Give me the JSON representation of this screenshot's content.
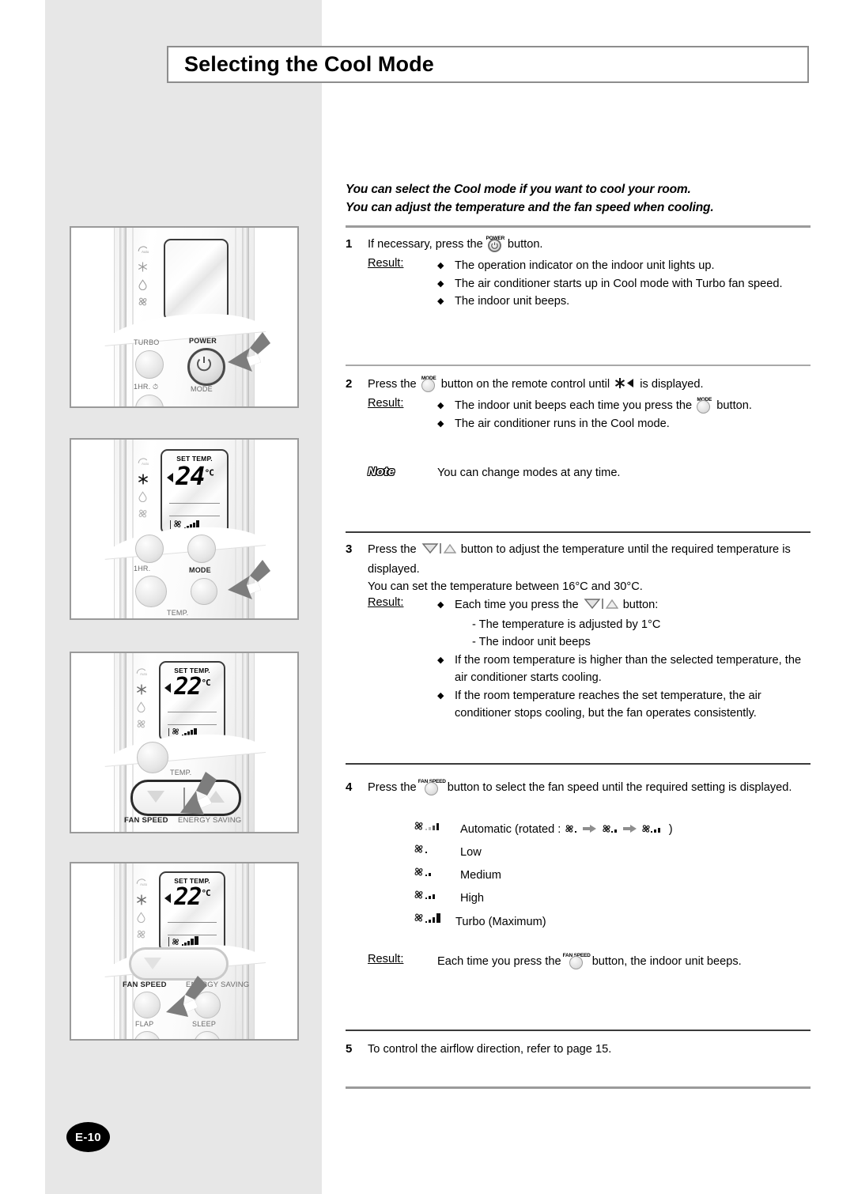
{
  "page": {
    "title": "Selecting the Cool Mode",
    "page_number": "E-10"
  },
  "intro": {
    "line1": "You can select the Cool mode if you want to cool your room.",
    "line2": "You can adjust the temperature and the fan speed when cooling."
  },
  "steps": {
    "step1": {
      "number": "1",
      "text_before": "If necessary, press the",
      "button_caption": "POWER",
      "text_after": "button.",
      "result_label": "Result:",
      "bullets": [
        "The operation indicator on the indoor unit lights up.",
        "The air conditioner starts up in Cool mode with Turbo fan speed.",
        "The indoor unit beeps."
      ]
    },
    "step2": {
      "number": "2",
      "text_before": "Press the",
      "button_caption": "MODE",
      "text_mid": "button on the remote control until",
      "text_after": "is displayed.",
      "result_label": "Result:",
      "bullet1_before": "The indoor unit beeps each time you press the",
      "bullet1_caption": "MODE",
      "bullet1_after": "button.",
      "bullet2": "The air conditioner runs in the Cool mode."
    },
    "note": {
      "label": "Note",
      "text": "You can change modes at any time."
    },
    "step3": {
      "number": "3",
      "text_before": "Press the",
      "text_after": "button to adjust the temperature until the required temperature is displayed.",
      "range_text": "You can set the temperature between 16°C and 30°C.",
      "result_label": "Result:",
      "bullet1_before": "Each time you press the",
      "bullet1_after": "button:",
      "sub1": "- The temperature is adjusted by 1°C",
      "sub2": "- The indoor unit beeps",
      "bullet2": "If the room temperature is higher than the selected temperature, the air conditioner starts cooling.",
      "bullet3": "If the room temperature reaches the set temperature, the air conditioner stops cooling, but the fan operates consistently."
    },
    "step4": {
      "number": "4",
      "text_before": "Press the",
      "button_caption": "FAN SPEED",
      "text_after": "button to select the fan speed until the required setting is displayed.",
      "speeds": [
        {
          "name": "Automatic",
          "suffix": "(rotated :",
          "bars": 3,
          "auto": true,
          "close": ")"
        },
        {
          "name": "Low",
          "bars": 0,
          "auto": false
        },
        {
          "name": "Medium",
          "bars": 1,
          "auto": false
        },
        {
          "name": "High",
          "bars": 2,
          "auto": false
        },
        {
          "name": "Turbo (Maximum)",
          "bars": 4,
          "auto": false
        }
      ],
      "result_label": "Result:",
      "result_before": "Each time you press the",
      "result_caption": "FAN SPEED",
      "result_after": "button, the indoor unit beeps."
    },
    "step5": {
      "number": "5",
      "text": "To control the airflow direction, refer to page 15."
    }
  },
  "panels": [
    {
      "id": "panel-1",
      "caption": "remote-power-button",
      "lcd_value": "",
      "lcd_label": "",
      "buttons": [
        "TURBO",
        "POWER",
        "1HR.",
        "MODE"
      ],
      "highlighted_button": "POWER"
    },
    {
      "id": "panel-2",
      "caption": "remote-mode-button",
      "lcd_label": "SET TEMP.",
      "lcd_value": "24",
      "lcd_unit": "°C",
      "buttons": [
        "1HR.",
        "MODE",
        "TEMP."
      ],
      "highlighted_button": "MODE"
    },
    {
      "id": "panel-3",
      "caption": "remote-temp-buttons",
      "lcd_label": "SET TEMP.",
      "lcd_value": "22",
      "lcd_unit": "°C",
      "buttons": [
        "TEMP.",
        "FAN SPEED",
        "ENERGY SAVING"
      ],
      "highlighted_button": "TEMP."
    },
    {
      "id": "panel-4",
      "caption": "remote-fan-speed-button",
      "lcd_label": "SET TEMP.",
      "lcd_value": "22",
      "lcd_unit": "°C",
      "buttons": [
        "FAN SPEED",
        "ENERGY SAVING",
        "FLAP",
        "SLEEP"
      ],
      "highlighted_button": "FAN SPEED"
    }
  ],
  "icons": {
    "mode_icons": [
      "auto-icon",
      "snowflake-icon",
      "dry-drop-icon",
      "fan-icon"
    ]
  },
  "colors": {
    "sidebar": "#e7e7e7",
    "rule": "#9b9b9b",
    "text": "#000000"
  }
}
